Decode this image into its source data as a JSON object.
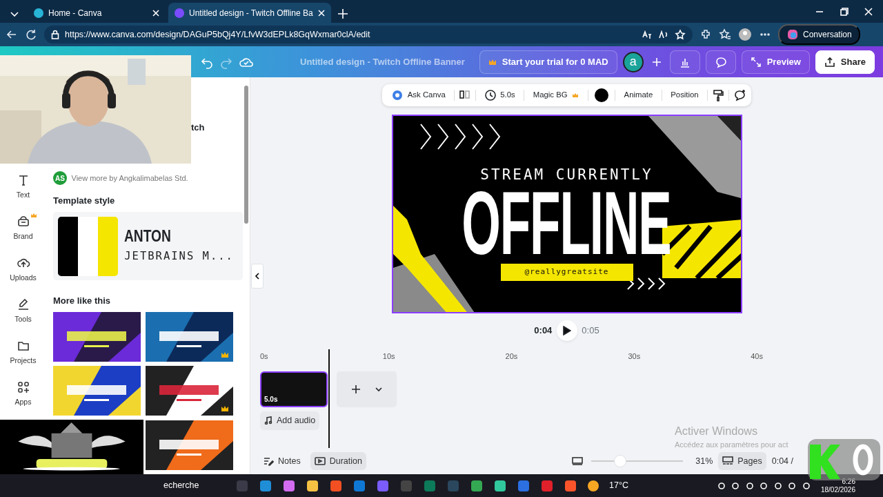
{
  "browser": {
    "tabs": [
      {
        "title": "Home - Canva",
        "selected": false
      },
      {
        "title": "Untitled design - Twitch Offline Ba",
        "selected": true
      }
    ],
    "url": "https://www.canva.com/design/DAGuP5bQj4Y/LfvW3dEPLk8GqWxmar0clA/edit",
    "copilot": "Conversation"
  },
  "header": {
    "title": "Untitled design - Twitch Offline Banner",
    "trial": "Start your trial for 0 MAD",
    "avatar": "a",
    "preview": "Preview",
    "share": "Share"
  },
  "sidebar": {
    "items": [
      {
        "label": "Text",
        "kind": "text",
        "premium": false
      },
      {
        "label": "Brand",
        "kind": "brand",
        "premium": true
      },
      {
        "label": "Uploads",
        "kind": "uploads",
        "premium": false
      },
      {
        "label": "Tools",
        "kind": "tools",
        "premium": false
      },
      {
        "label": "Projects",
        "kind": "projects",
        "premium": false
      },
      {
        "label": "Apps",
        "kind": "apps",
        "premium": false
      }
    ]
  },
  "panel": {
    "partial_heading": "tch",
    "author_initials": "AS",
    "author_link": "View more by Angkalimabelas Std.",
    "style_heading": "Template style",
    "palette": [
      {
        "color": "#000000"
      },
      {
        "color": "#ffffff"
      },
      {
        "color": "#f5e600"
      }
    ],
    "fonts": [
      "ANTON",
      "JETBRAINS M..."
    ],
    "more_heading": "More like this",
    "templates": [
      {
        "premium": false
      },
      {
        "premium": true
      },
      {
        "premium": false
      },
      {
        "premium": true
      },
      {
        "premium": false
      }
    ]
  },
  "toolbar": {
    "items": [
      {
        "kind": "ask",
        "label": "Ask Canva"
      },
      {
        "kind": "flip"
      },
      {
        "kind": "duration",
        "label": "5.0s"
      },
      {
        "kind": "magic",
        "label": "Magic BG"
      },
      {
        "kind": "color",
        "color": "#000000"
      },
      {
        "kind": "text",
        "label": "Animate"
      },
      {
        "kind": "text",
        "label": "Position"
      },
      {
        "kind": "paint"
      },
      {
        "kind": "comment"
      }
    ]
  },
  "design": {
    "subtitle": "STREAM CURRENTLY",
    "title": "OFFLINE",
    "handle": "@reallygreatsite"
  },
  "playback": {
    "current": "0:04",
    "total": "0:05"
  },
  "timeline": {
    "ticks": [
      "0s",
      "10s",
      "20s",
      "30s",
      "40s"
    ],
    "clip_duration": "5.0s",
    "add_audio": "Add audio"
  },
  "footer": {
    "notes": "Notes",
    "duration": "Duration",
    "duration_selected": true,
    "level": 0.32,
    "zoom": "31%",
    "pages": "Pages",
    "time": "0:04 /"
  },
  "windows_notice": {
    "title": "Activer Windows",
    "body": "Accédez aux paramètres pour act"
  },
  "taskbar": {
    "search": "echerche",
    "temperature": "17°C",
    "time": "6:26",
    "date": "18/02/2026"
  }
}
